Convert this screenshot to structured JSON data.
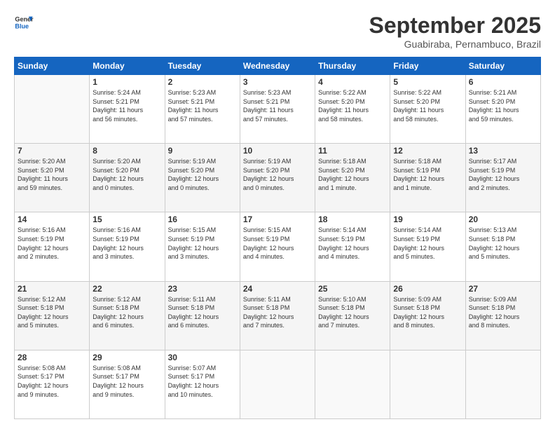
{
  "header": {
    "logo_line1": "General",
    "logo_line2": "Blue",
    "month": "September 2025",
    "location": "Guabiraba, Pernambuco, Brazil"
  },
  "weekdays": [
    "Sunday",
    "Monday",
    "Tuesday",
    "Wednesday",
    "Thursday",
    "Friday",
    "Saturday"
  ],
  "weeks": [
    [
      {
        "day": "",
        "info": ""
      },
      {
        "day": "1",
        "info": "Sunrise: 5:24 AM\nSunset: 5:21 PM\nDaylight: 11 hours\nand 56 minutes."
      },
      {
        "day": "2",
        "info": "Sunrise: 5:23 AM\nSunset: 5:21 PM\nDaylight: 11 hours\nand 57 minutes."
      },
      {
        "day": "3",
        "info": "Sunrise: 5:23 AM\nSunset: 5:21 PM\nDaylight: 11 hours\nand 57 minutes."
      },
      {
        "day": "4",
        "info": "Sunrise: 5:22 AM\nSunset: 5:20 PM\nDaylight: 11 hours\nand 58 minutes."
      },
      {
        "day": "5",
        "info": "Sunrise: 5:22 AM\nSunset: 5:20 PM\nDaylight: 11 hours\nand 58 minutes."
      },
      {
        "day": "6",
        "info": "Sunrise: 5:21 AM\nSunset: 5:20 PM\nDaylight: 11 hours\nand 59 minutes."
      }
    ],
    [
      {
        "day": "7",
        "info": "Sunrise: 5:20 AM\nSunset: 5:20 PM\nDaylight: 11 hours\nand 59 minutes."
      },
      {
        "day": "8",
        "info": "Sunrise: 5:20 AM\nSunset: 5:20 PM\nDaylight: 12 hours\nand 0 minutes."
      },
      {
        "day": "9",
        "info": "Sunrise: 5:19 AM\nSunset: 5:20 PM\nDaylight: 12 hours\nand 0 minutes."
      },
      {
        "day": "10",
        "info": "Sunrise: 5:19 AM\nSunset: 5:20 PM\nDaylight: 12 hours\nand 0 minutes."
      },
      {
        "day": "11",
        "info": "Sunrise: 5:18 AM\nSunset: 5:20 PM\nDaylight: 12 hours\nand 1 minute."
      },
      {
        "day": "12",
        "info": "Sunrise: 5:18 AM\nSunset: 5:19 PM\nDaylight: 12 hours\nand 1 minute."
      },
      {
        "day": "13",
        "info": "Sunrise: 5:17 AM\nSunset: 5:19 PM\nDaylight: 12 hours\nand 2 minutes."
      }
    ],
    [
      {
        "day": "14",
        "info": "Sunrise: 5:16 AM\nSunset: 5:19 PM\nDaylight: 12 hours\nand 2 minutes."
      },
      {
        "day": "15",
        "info": "Sunrise: 5:16 AM\nSunset: 5:19 PM\nDaylight: 12 hours\nand 3 minutes."
      },
      {
        "day": "16",
        "info": "Sunrise: 5:15 AM\nSunset: 5:19 PM\nDaylight: 12 hours\nand 3 minutes."
      },
      {
        "day": "17",
        "info": "Sunrise: 5:15 AM\nSunset: 5:19 PM\nDaylight: 12 hours\nand 4 minutes."
      },
      {
        "day": "18",
        "info": "Sunrise: 5:14 AM\nSunset: 5:19 PM\nDaylight: 12 hours\nand 4 minutes."
      },
      {
        "day": "19",
        "info": "Sunrise: 5:14 AM\nSunset: 5:19 PM\nDaylight: 12 hours\nand 5 minutes."
      },
      {
        "day": "20",
        "info": "Sunrise: 5:13 AM\nSunset: 5:18 PM\nDaylight: 12 hours\nand 5 minutes."
      }
    ],
    [
      {
        "day": "21",
        "info": "Sunrise: 5:12 AM\nSunset: 5:18 PM\nDaylight: 12 hours\nand 5 minutes."
      },
      {
        "day": "22",
        "info": "Sunrise: 5:12 AM\nSunset: 5:18 PM\nDaylight: 12 hours\nand 6 minutes."
      },
      {
        "day": "23",
        "info": "Sunrise: 5:11 AM\nSunset: 5:18 PM\nDaylight: 12 hours\nand 6 minutes."
      },
      {
        "day": "24",
        "info": "Sunrise: 5:11 AM\nSunset: 5:18 PM\nDaylight: 12 hours\nand 7 minutes."
      },
      {
        "day": "25",
        "info": "Sunrise: 5:10 AM\nSunset: 5:18 PM\nDaylight: 12 hours\nand 7 minutes."
      },
      {
        "day": "26",
        "info": "Sunrise: 5:09 AM\nSunset: 5:18 PM\nDaylight: 12 hours\nand 8 minutes."
      },
      {
        "day": "27",
        "info": "Sunrise: 5:09 AM\nSunset: 5:18 PM\nDaylight: 12 hours\nand 8 minutes."
      }
    ],
    [
      {
        "day": "28",
        "info": "Sunrise: 5:08 AM\nSunset: 5:17 PM\nDaylight: 12 hours\nand 9 minutes."
      },
      {
        "day": "29",
        "info": "Sunrise: 5:08 AM\nSunset: 5:17 PM\nDaylight: 12 hours\nand 9 minutes."
      },
      {
        "day": "30",
        "info": "Sunrise: 5:07 AM\nSunset: 5:17 PM\nDaylight: 12 hours\nand 10 minutes."
      },
      {
        "day": "",
        "info": ""
      },
      {
        "day": "",
        "info": ""
      },
      {
        "day": "",
        "info": ""
      },
      {
        "day": "",
        "info": ""
      }
    ]
  ]
}
